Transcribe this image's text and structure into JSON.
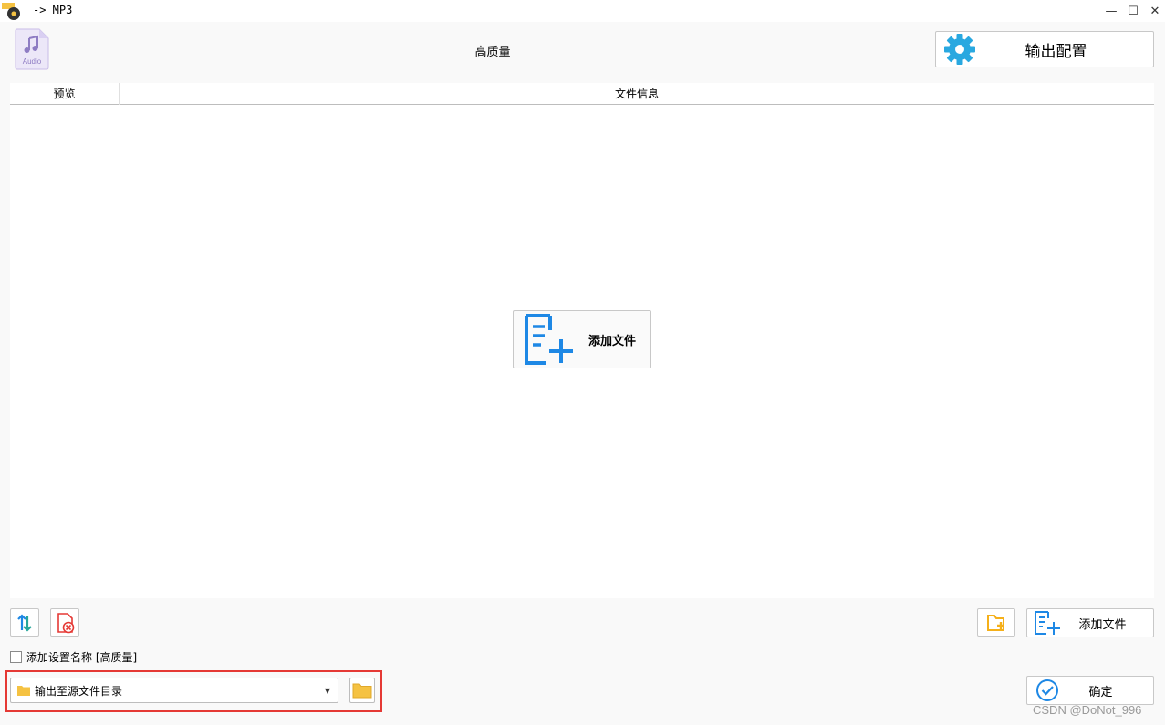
{
  "window": {
    "title": "-> MP3",
    "controls": {
      "minimize": "—",
      "maximize": "☐",
      "close": "✕"
    }
  },
  "header": {
    "audio_icon_label": "Audio",
    "preset_name": "高质量",
    "output_config_label": "输出配置"
  },
  "table": {
    "columns": [
      "预览",
      "文件信息"
    ],
    "rows": [],
    "empty_add_label": "添加文件"
  },
  "toolbar": {
    "add_file_label": "添加文件"
  },
  "options": {
    "add_setting_name_label": "添加设置名称 [高质量]",
    "add_setting_name_checked": false
  },
  "output": {
    "selected": "输出至源文件目录"
  },
  "actions": {
    "confirm_label": "确定"
  },
  "watermark": "CSDN @DoNot_996",
  "colors": {
    "accent_blue": "#1e88e5",
    "gear_blue": "#29a8e0",
    "folder_yellow": "#f5c242",
    "delete_red": "#e53935",
    "highlight_red": "#e53935",
    "audio_purple": "#8e7cc3"
  }
}
